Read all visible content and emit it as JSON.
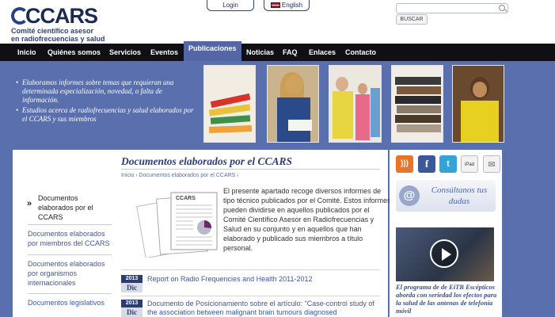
{
  "logo": {
    "word": "CCARS",
    "line1": "Comité científico asesor",
    "line2": "en radiofrecuencias y salud"
  },
  "topbar": {
    "login": "Login",
    "language": "English"
  },
  "search": {
    "button": "BUSCAR",
    "placeholder": ""
  },
  "nav": {
    "items": [
      "Inicio",
      "Quiénes somos",
      "Servicios",
      "Eventos",
      "Publicaciones",
      "Noticias",
      "FAQ",
      "Enlaces",
      "Contacto"
    ],
    "active": "Publicaciones"
  },
  "banner": {
    "bullets": [
      "Elaboramos informes sobre temas que requieran una determinada especialización, novedad, o falta de información.",
      "Estudios acerca de radiofrecuencias y salud elaborados por el CCARS y sus miembros"
    ]
  },
  "page": {
    "title": "Documentos elaborados por el CCARS",
    "breadcrumb": "Inicio › Documentos elaborados por el CCARS ›",
    "intro": "El presente apartado recoge diversos informes de tipo técnico publicados por el Comité. Estos informes pueden dividirse en aquellos publicados por el Comité Científico Asesor en Radiofrecuencias y Salud en su conjunto y en aquellos que han elaborado y publicado sus miembros a título personal.",
    "doc_image_label": "CCARS"
  },
  "sidebar": {
    "active": "Documentos elaborados por el CCARS",
    "items": [
      "Documentos elaborados por miembros del CCARS",
      "Documentos elaborados por organismos internacionales",
      "Documentos legislativos"
    ]
  },
  "documents": [
    {
      "year": "2013",
      "month": "Dic",
      "title": "Report on Radio Frequencies and Health 2011-2012"
    },
    {
      "year": "2013",
      "month": "Dic",
      "title": "Documento de Posicionamiento sobre el artículo: \"Case-control study of the association between malignant brain tumours diagnosed"
    }
  ],
  "right": {
    "social": [
      "rss-icon",
      "facebook-icon",
      "twitter-icon",
      "ipad-icon",
      "mail-icon"
    ],
    "ipad_label": "iPad",
    "contact": "Consúltanos tus dudas",
    "video_caption": "El programa de de EiTB Escépticos aborda con seriedad los efectos para la salud de las antenas de telefonía móvil"
  },
  "colors": {
    "brand": "#2a3f86",
    "nav_bg": "#0f0f14",
    "page_bg": "#5a6fad",
    "link": "#3e58a4"
  }
}
